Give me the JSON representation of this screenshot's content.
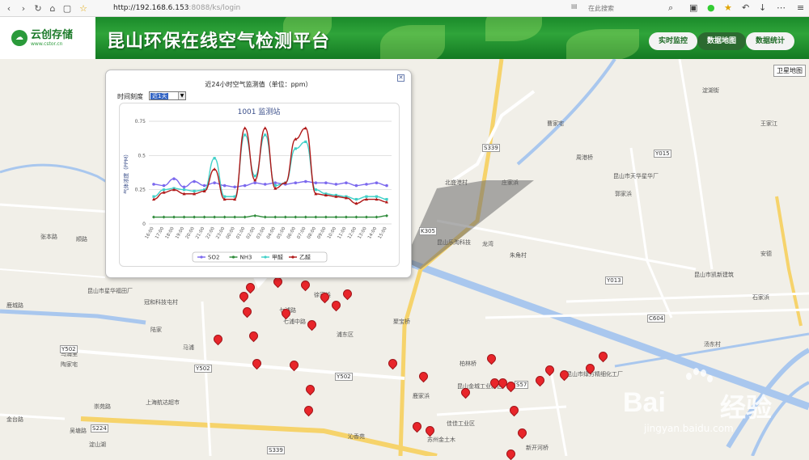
{
  "browser": {
    "url_main": "http://192.168.6.153",
    "url_rest": ":8088/ks/login",
    "search_placeholder": "在此搜索"
  },
  "header": {
    "logo_text": "云创存储",
    "logo_sub": "www.cstor.cn",
    "title": "昆山环保在线空气检测平台",
    "nav": [
      "实时监控",
      "数据地图",
      "数据统计"
    ]
  },
  "map": {
    "road_labels": [
      "Y013",
      "S339",
      "K305",
      "Y015",
      "Y502",
      "C604",
      "S57",
      "Y502",
      "Y502",
      "S224",
      "S339"
    ],
    "labels": [
      "卫星地图",
      "张本路",
      "顺路",
      "昆山市星华福田厂",
      "冠和科技屯村",
      "徐家浜",
      "七浦中路",
      "浦东区",
      "七浦路",
      "陆家",
      "马浦",
      "乌浦里",
      "北盛港村",
      "龙湾",
      "朱角村",
      "淀湖街",
      "庄家浜",
      "汤东村",
      "曹家宅",
      "王家江",
      "周港桥",
      "昆山市天华星华厂",
      "郭家浜",
      "昆山市凯新建筑",
      "安德",
      "石家浜",
      "昆山乐淘科技",
      "昆山市绿方精细化工厂",
      "新开河桥",
      "佳佳工业区",
      "昆山金城工业新区",
      "鹿家浜",
      "沁香苑",
      "苏州金土木",
      "上海航达超市",
      "金台路",
      "吴塘路",
      "淀山湖",
      "陶家宅",
      "崇苑路",
      "鹿城路",
      "聚宝桥",
      "柏林桥"
    ]
  },
  "popup": {
    "title": "近24小时空气监测值（单位：ppm）",
    "time_label": "时间刻度",
    "time_value": "近1天",
    "close_glyph": "✕"
  },
  "chart_data": {
    "type": "line",
    "title": "1001 监测站",
    "ylabel": "气体浓度（PPM）",
    "ylim": [
      0,
      0.75
    ],
    "yticks": [
      0,
      0.25,
      0.5,
      0.75
    ],
    "categories": [
      "16:00",
      "17:00",
      "18:00",
      "19:00",
      "20:00",
      "21:00",
      "22:00",
      "23:00",
      "00:00",
      "01:00",
      "02:00",
      "03:00",
      "04:00",
      "05:00",
      "06:00",
      "07:00",
      "08:00",
      "09:00",
      "10:00",
      "11:00",
      "12:00",
      "13:00",
      "14:00",
      "15:00"
    ],
    "series": [
      {
        "name": "SO2",
        "color": "#7b68ee",
        "marker": "circle",
        "values": [
          0.29,
          0.28,
          0.33,
          0.27,
          0.31,
          0.28,
          0.3,
          0.28,
          0.27,
          0.28,
          0.3,
          0.29,
          0.3,
          0.29,
          0.3,
          0.31,
          0.3,
          0.3,
          0.29,
          0.3,
          0.28,
          0.29,
          0.3,
          0.28
        ]
      },
      {
        "name": "NH3",
        "color": "#2e8b3a",
        "marker": "diamond",
        "values": [
          0.05,
          0.05,
          0.05,
          0.05,
          0.05,
          0.05,
          0.05,
          0.05,
          0.05,
          0.05,
          0.06,
          0.05,
          0.05,
          0.05,
          0.05,
          0.05,
          0.05,
          0.05,
          0.05,
          0.05,
          0.05,
          0.05,
          0.05,
          0.06
        ]
      },
      {
        "name": "甲醛",
        "color": "#40d0c8",
        "marker": "square",
        "values": [
          0.2,
          0.25,
          0.26,
          0.25,
          0.24,
          0.25,
          0.48,
          0.2,
          0.2,
          0.65,
          0.35,
          0.65,
          0.28,
          0.3,
          0.55,
          0.6,
          0.25,
          0.22,
          0.21,
          0.2,
          0.18,
          0.2,
          0.2,
          0.18
        ]
      },
      {
        "name": "乙醛",
        "color": "#b01818",
        "marker": "triangle",
        "values": [
          0.18,
          0.23,
          0.25,
          0.22,
          0.22,
          0.24,
          0.4,
          0.18,
          0.18,
          0.7,
          0.32,
          0.7,
          0.26,
          0.3,
          0.62,
          0.7,
          0.22,
          0.21,
          0.2,
          0.19,
          0.15,
          0.18,
          0.18,
          0.16
        ]
      }
    ],
    "grid": true,
    "legend": "bottom"
  },
  "watermark": {
    "brand": "Bai",
    "brand2": "经验",
    "site": "jingyan.baidu.com"
  }
}
